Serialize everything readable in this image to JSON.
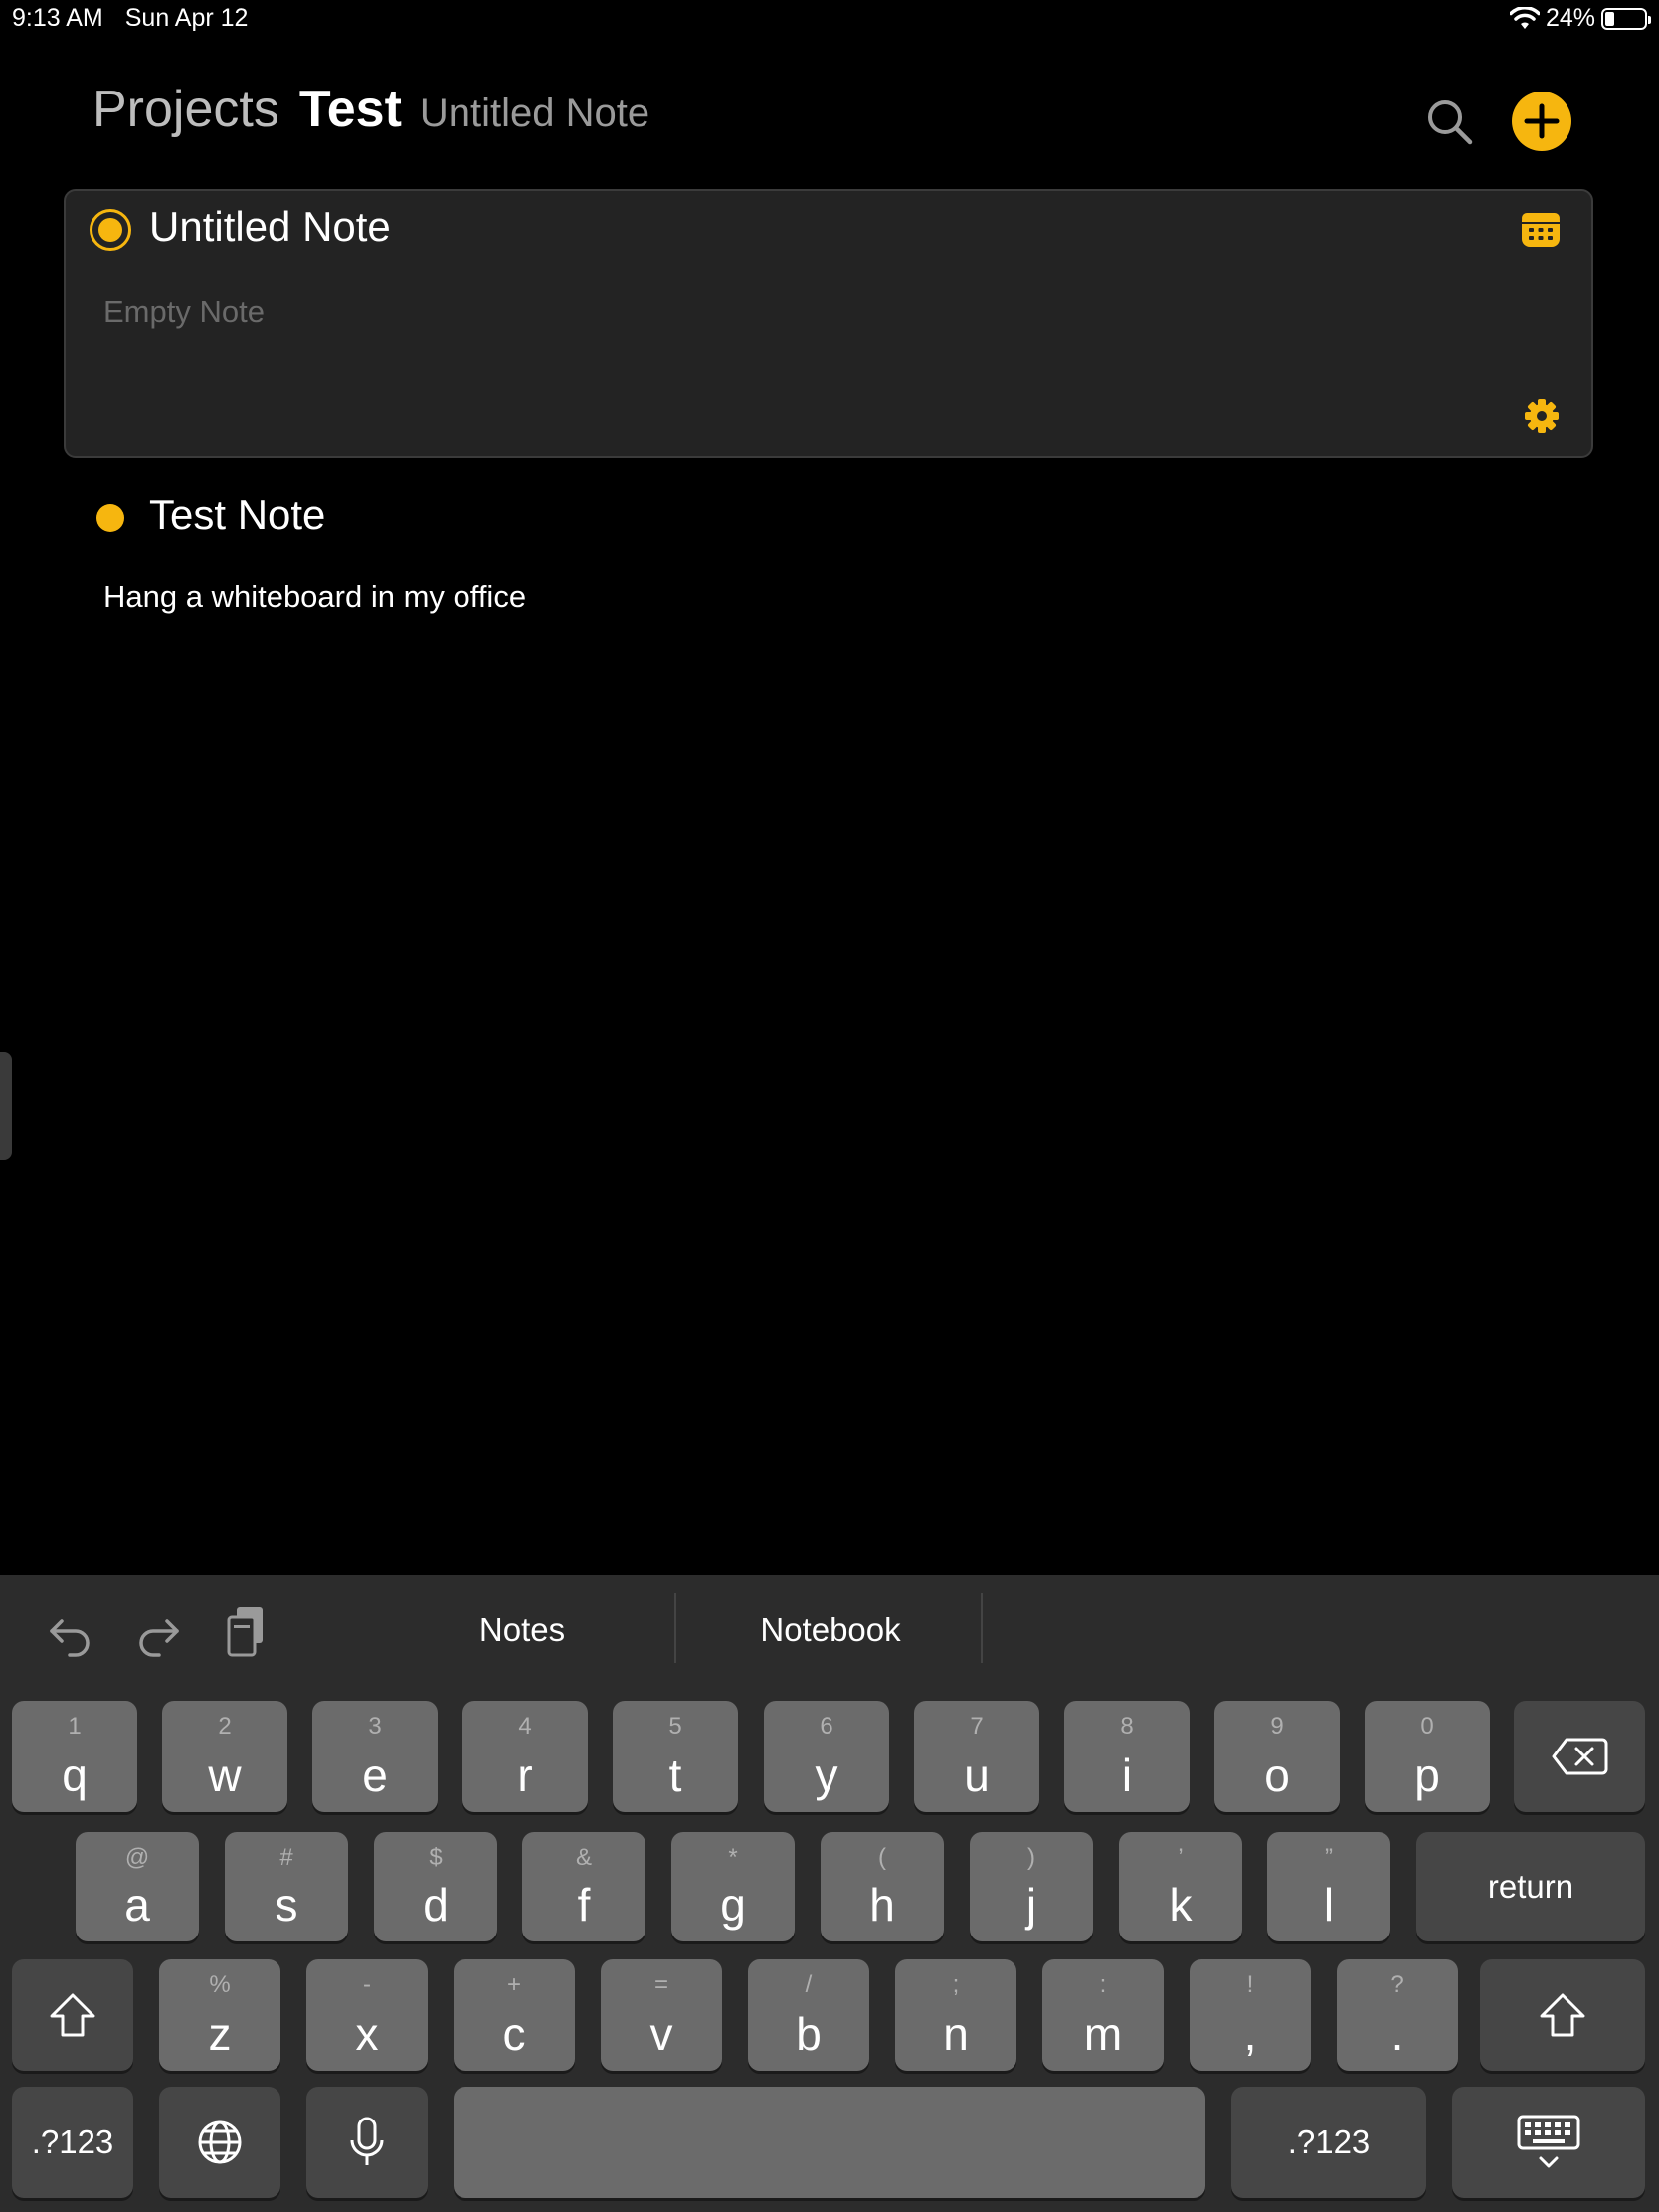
{
  "status_bar": {
    "time": "9:13 AM",
    "date": "Sun Apr 12",
    "battery": "24%",
    "battery_level": 0.24,
    "wifi_icon": "wifi-icon"
  },
  "header": {
    "root": "Projects",
    "current": "Test",
    "subtitle": "Untitled Note"
  },
  "notes": [
    {
      "title": "Untitled Note",
      "body_placeholder": "Empty Note",
      "selected": true
    },
    {
      "title": "Test Note",
      "body": "Hang a whiteboard in my office",
      "selected": false
    }
  ],
  "colors": {
    "accent": "#f6b60f",
    "background": "#000000",
    "card": "#232323",
    "keyboard": "#2c2c2c"
  },
  "keyboard": {
    "suggestions": [
      "Notes",
      "Notebook"
    ],
    "row1": [
      {
        "main": "q",
        "sub": "1"
      },
      {
        "main": "w",
        "sub": "2"
      },
      {
        "main": "e",
        "sub": "3"
      },
      {
        "main": "r",
        "sub": "4"
      },
      {
        "main": "t",
        "sub": "5"
      },
      {
        "main": "y",
        "sub": "6"
      },
      {
        "main": "u",
        "sub": "7"
      },
      {
        "main": "i",
        "sub": "8"
      },
      {
        "main": "o",
        "sub": "9"
      },
      {
        "main": "p",
        "sub": "0"
      }
    ],
    "row2": [
      {
        "main": "a",
        "sub": "@"
      },
      {
        "main": "s",
        "sub": "#"
      },
      {
        "main": "d",
        "sub": "$"
      },
      {
        "main": "f",
        "sub": "&"
      },
      {
        "main": "g",
        "sub": "*"
      },
      {
        "main": "h",
        "sub": "("
      },
      {
        "main": "j",
        "sub": ")"
      },
      {
        "main": "k",
        "sub": "’"
      },
      {
        "main": "l",
        "sub": "”"
      }
    ],
    "row3": [
      {
        "main": "z",
        "sub": "%"
      },
      {
        "main": "x",
        "sub": "-"
      },
      {
        "main": "c",
        "sub": "+"
      },
      {
        "main": "v",
        "sub": "="
      },
      {
        "main": "b",
        "sub": "/"
      },
      {
        "main": "n",
        "sub": ";"
      },
      {
        "main": "m",
        "sub": ":"
      },
      {
        "main": ",",
        "sub": "!"
      },
      {
        "main": ".",
        "sub": "?"
      }
    ],
    "return_label": "return",
    "numbers_label": ".?123"
  }
}
